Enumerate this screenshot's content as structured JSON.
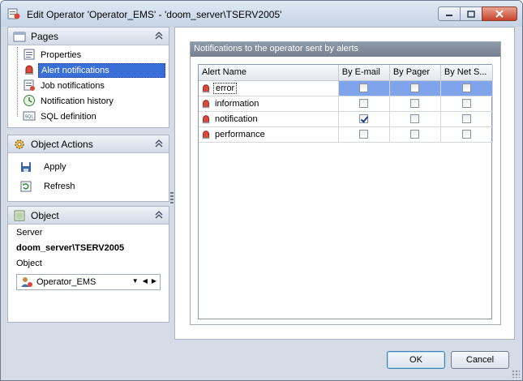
{
  "window": {
    "title": "Edit Operator 'Operator_EMS' - 'doom_server\\TSERV2005'"
  },
  "pages_panel": {
    "title": "Pages",
    "items": [
      {
        "label": "Properties",
        "icon": "properties-icon"
      },
      {
        "label": "Alert notifications",
        "icon": "alert-bell-icon",
        "selected": true
      },
      {
        "label": "Job notifications",
        "icon": "job-icon"
      },
      {
        "label": "Notification history",
        "icon": "history-icon"
      },
      {
        "label": "SQL definition",
        "icon": "sql-icon"
      }
    ]
  },
  "actions_panel": {
    "title": "Object Actions",
    "items": [
      {
        "label": "Apply",
        "icon": "save-icon"
      },
      {
        "label": "Refresh",
        "icon": "refresh-icon"
      }
    ]
  },
  "object_panel": {
    "title": "Object",
    "server_label": "Server",
    "server_value": "doom_server\\TSERV2005",
    "object_label": "Object",
    "object_value": "Operator_EMS"
  },
  "notifications": {
    "group_title": "Notifications to the operator sent by alerts",
    "columns": [
      "Alert Name",
      "By E-mail",
      "By Pager",
      "By Net S..."
    ],
    "rows": [
      {
        "name": "error",
        "email": false,
        "pager": false,
        "net": false,
        "selected": true
      },
      {
        "name": "information",
        "email": false,
        "pager": false,
        "net": false
      },
      {
        "name": "notification",
        "email": true,
        "pager": false,
        "net": false
      },
      {
        "name": "performance",
        "email": false,
        "pager": false,
        "net": false
      }
    ]
  },
  "buttons": {
    "ok": "OK",
    "cancel": "Cancel"
  },
  "colors": {
    "selection": "#3a6fd8",
    "row_selection": "#7fa4ec",
    "group_header": "#838e9d"
  }
}
